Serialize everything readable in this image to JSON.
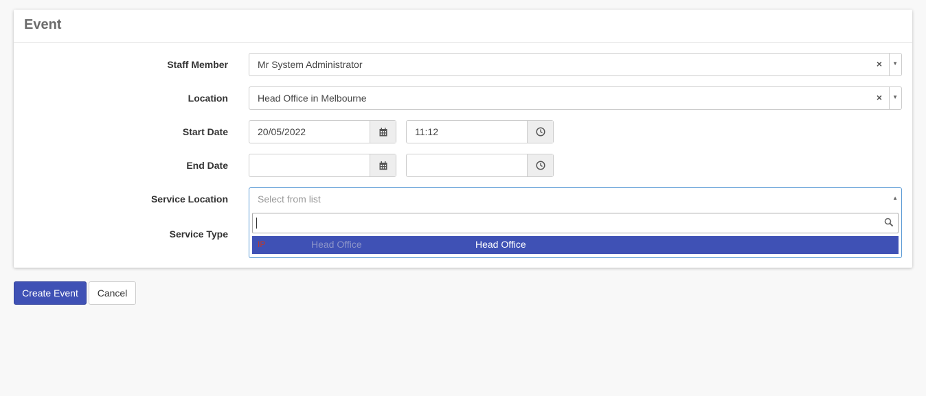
{
  "panel": {
    "title": "Event"
  },
  "fields": {
    "staff_member": {
      "label": "Staff Member",
      "value": "Mr System Administrator",
      "clear": "×",
      "arrow": "▼"
    },
    "location": {
      "label": "Location",
      "value": "Head Office in Melbourne",
      "clear": "×",
      "arrow": "▼"
    },
    "start_date": {
      "label": "Start Date",
      "date": "20/05/2022",
      "time": "11:12"
    },
    "end_date": {
      "label": "End Date",
      "date": "",
      "time": ""
    },
    "service_location": {
      "label": "Service Location",
      "placeholder": "Select from list",
      "arrow": "▲"
    },
    "service_type": {
      "label": "Service Type"
    }
  },
  "dropdown": {
    "search_value": "",
    "options": [
      {
        "code": "IP",
        "col2": "Head Office",
        "col3": "Head Office",
        "highlighted": true
      }
    ]
  },
  "buttons": {
    "create": "Create Event",
    "cancel": "Cancel"
  },
  "colors": {
    "primary": "#3f51b5",
    "focus_border": "#5b9bd5",
    "code_red": "#c0392b"
  }
}
